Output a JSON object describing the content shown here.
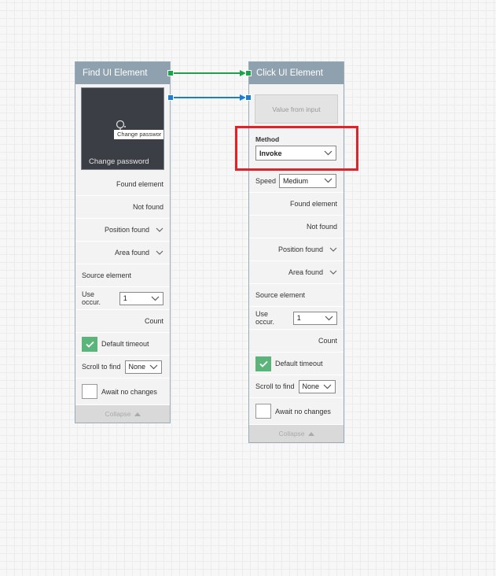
{
  "colors": {
    "header_bg": "#8fa1ae",
    "success_port": "#1aa34a",
    "data_port": "#1a7fd4",
    "checkbox_checked": "#5bb57a",
    "highlight": "#e0232b"
  },
  "find_node": {
    "title": "Find UI Element",
    "preview_tooltip": "Change passwor",
    "preview_caption": "Change password",
    "found_element": "Found element",
    "not_found": "Not found",
    "position_found": "Position found",
    "area_found": "Area found",
    "source_element": "Source element",
    "use_occur_label": "Use occur.",
    "use_occur_value": "1",
    "count": "Count",
    "default_timeout": "Default timeout",
    "default_timeout_checked": true,
    "scroll_to_find_label": "Scroll to find",
    "scroll_to_find_value": "None",
    "await_no_changes": "Await no changes",
    "await_no_changes_checked": false,
    "collapse": "Collapse"
  },
  "click_node": {
    "title": "Click UI Element",
    "value_from_input": "Value from input",
    "method_label": "Method",
    "method_value": "Invoke",
    "speed_label": "Speed",
    "speed_value": "Medium",
    "found_element": "Found element",
    "not_found": "Not found",
    "position_found": "Position found",
    "area_found": "Area found",
    "source_element": "Source element",
    "use_occur_label": "Use occur.",
    "use_occur_value": "1",
    "count": "Count",
    "default_timeout": "Default timeout",
    "default_timeout_checked": true,
    "scroll_to_find_label": "Scroll to find",
    "scroll_to_find_value": "None",
    "await_no_changes": "Await no changes",
    "await_no_changes_checked": false,
    "collapse": "Collapse"
  }
}
